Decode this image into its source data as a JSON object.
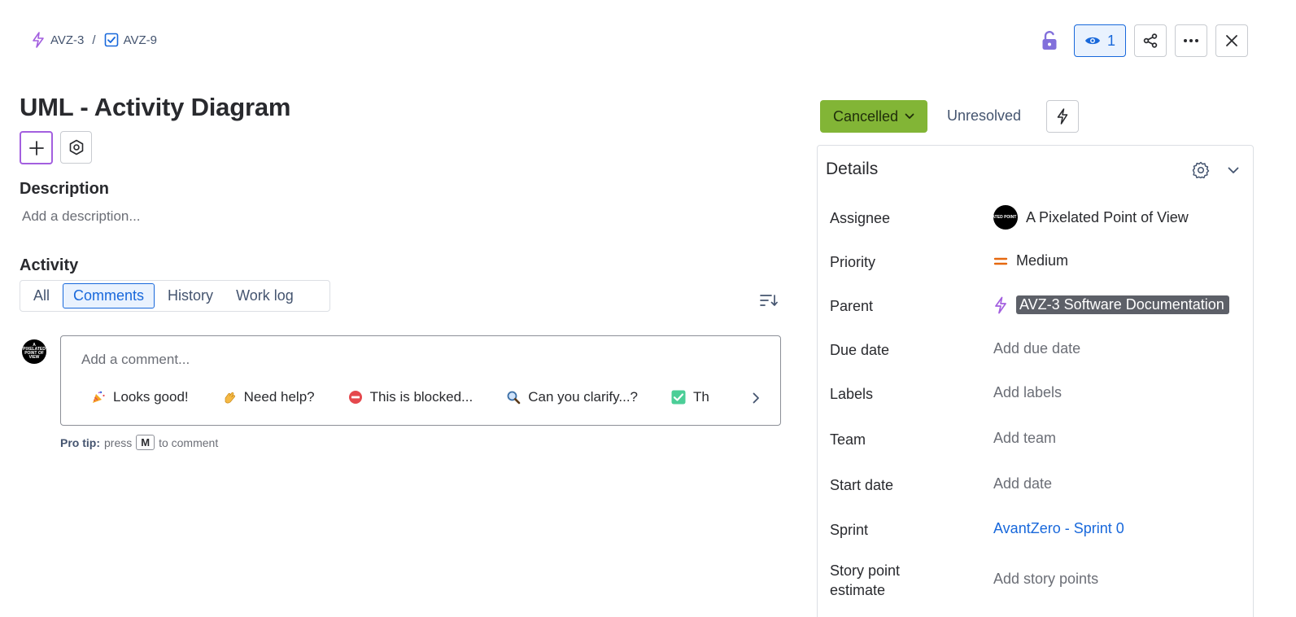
{
  "breadcrumb": {
    "parent_key": "AVZ-3",
    "separator": "/",
    "issue_key": "AVZ-9"
  },
  "top_actions": {
    "watch_count": "1"
  },
  "issue": {
    "title": "UML - Activity Diagram"
  },
  "description": {
    "heading": "Description",
    "placeholder": "Add a description..."
  },
  "activity": {
    "heading": "Activity",
    "tabs": [
      "All",
      "Comments",
      "History",
      "Work log"
    ],
    "active_tab": "Comments"
  },
  "comment": {
    "avatar_text": "A PIXELATED POINT OF VIEW",
    "placeholder": "Add a comment...",
    "quick_replies": [
      {
        "emoji": "party-popper-icon",
        "label": "Looks good!"
      },
      {
        "emoji": "waving-hand-icon",
        "label": "Need help?"
      },
      {
        "emoji": "no-entry-icon",
        "label": "This is blocked..."
      },
      {
        "emoji": "magnifier-icon",
        "label": "Can you clarify...?"
      },
      {
        "emoji": "check-mark-icon",
        "label": "Th"
      }
    ],
    "pro_tip_label": "Pro tip:",
    "pro_tip_press": "press",
    "pro_tip_key": "M",
    "pro_tip_suffix": "to comment"
  },
  "status": {
    "label": "Cancelled",
    "color": "#82b536",
    "resolution": "Unresolved"
  },
  "details": {
    "title": "Details",
    "fields": {
      "assignee": {
        "label": "Assignee",
        "value": "A Pixelated Point of View"
      },
      "priority": {
        "label": "Priority",
        "value": "Medium",
        "color": "#e56910"
      },
      "parent": {
        "label": "Parent",
        "value": "AVZ-3 Software Documentation"
      },
      "due_date": {
        "label": "Due date",
        "value": "Add due date"
      },
      "labels": {
        "label": "Labels",
        "value": "Add labels"
      },
      "team": {
        "label": "Team",
        "value": "Add team"
      },
      "start_date": {
        "label": "Start date",
        "value": "Add date"
      },
      "sprint": {
        "label": "Sprint",
        "value": "AvantZero - Sprint 0"
      },
      "story_points": {
        "label": "Story point estimate",
        "value": "Add story points"
      }
    }
  },
  "colors": {
    "accent": "#1868db",
    "epic_purple": "#a35fdf",
    "lock_purple": "#8270db"
  }
}
